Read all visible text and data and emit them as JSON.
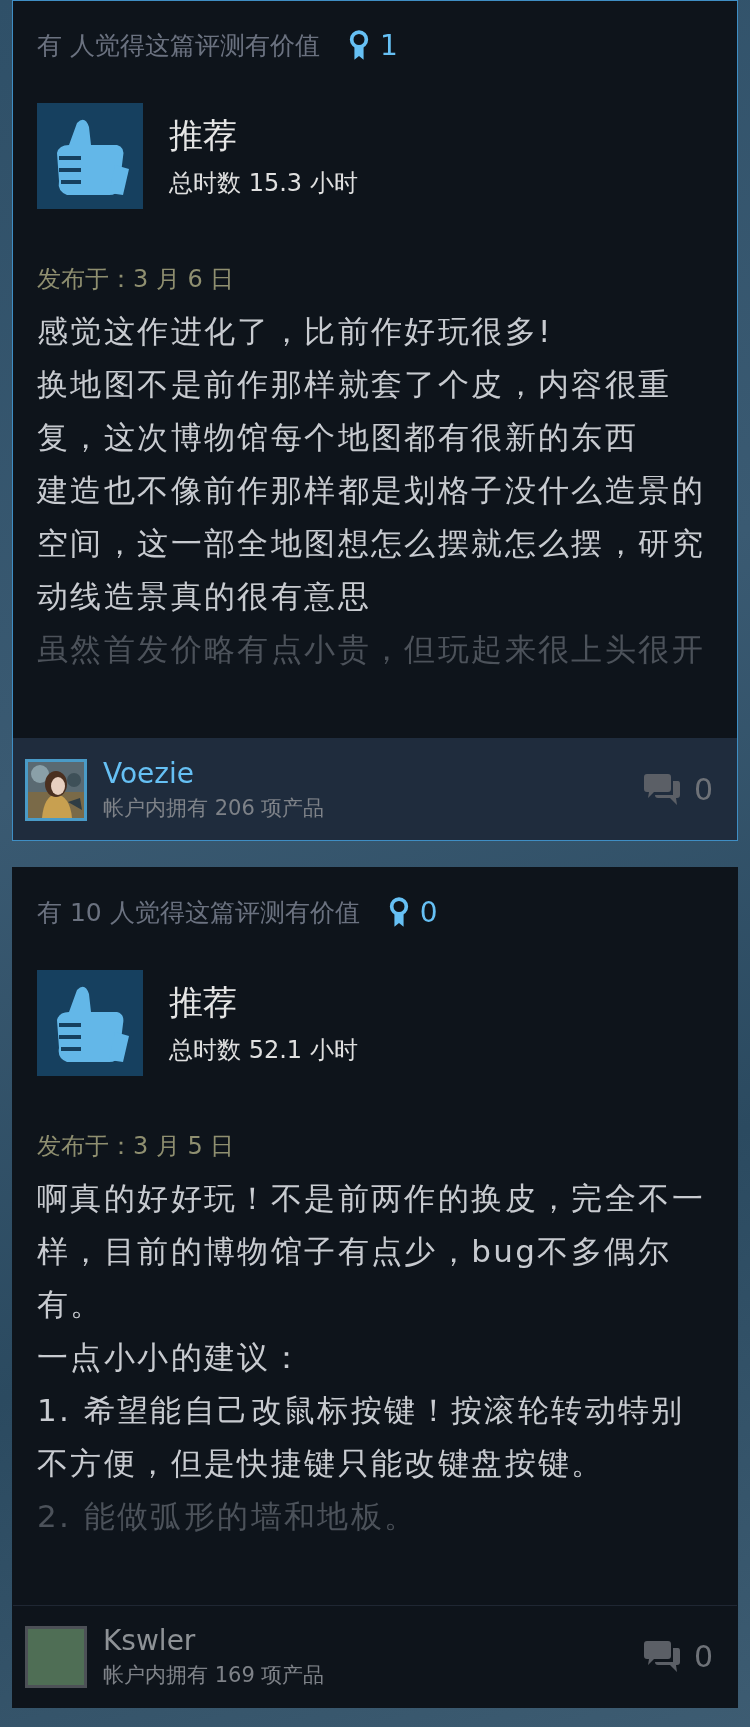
{
  "reviews": [
    {
      "selected": true,
      "helpful_text": "有 人觉得这篇评测有价值",
      "award_count": "1",
      "verdict": "推荐",
      "hours": "总时数 15.3 小时",
      "posted": "发布于：3 月 6 日",
      "paragraphs": [
        {
          "text": "感觉这作进化了，比前作好玩很多!",
          "faded": false
        },
        {
          "text": "换地图不是前作那样就套了个皮，内容很重复，这次博物馆每个地图都有很新的东西",
          "faded": false
        },
        {
          "text": "建造也不像前作那样都是划格子没什么造景的空间，这一部全地图想怎么摆就怎么摆，研究动线造景真的很有意思",
          "faded": false
        },
        {
          "text": "虽然首发价略有点小贵，但玩起来很上头很开",
          "faded": true
        }
      ],
      "author": {
        "name": "Voezie",
        "products": "帐户内拥有 206 项产品",
        "kind": "picture"
      },
      "comment_count": "0"
    },
    {
      "selected": false,
      "helpful_text": "有 10 人觉得这篇评测有价值",
      "award_count": "0",
      "verdict": "推荐",
      "hours": "总时数 52.1 小时",
      "posted": "发布于：3 月 5 日",
      "paragraphs": [
        {
          "text": "啊真的好好玩！不是前两作的换皮，完全不一样，目前的博物馆子有点少，bug不多偶尔有。",
          "faded": false
        },
        {
          "text": "一点小小的建议：",
          "faded": false
        },
        {
          "text": "1. 希望能自己改鼠标按键！按滚轮转动特别不方便，但是快捷键只能改键盘按键。",
          "faded": false
        },
        {
          "text": "2. 能做弧形的墙和地板。",
          "faded": true
        }
      ],
      "author": {
        "name": "Kswler",
        "products": "帐户内拥有 169 项产品",
        "kind": "default"
      },
      "comment_count": "0"
    }
  ]
}
